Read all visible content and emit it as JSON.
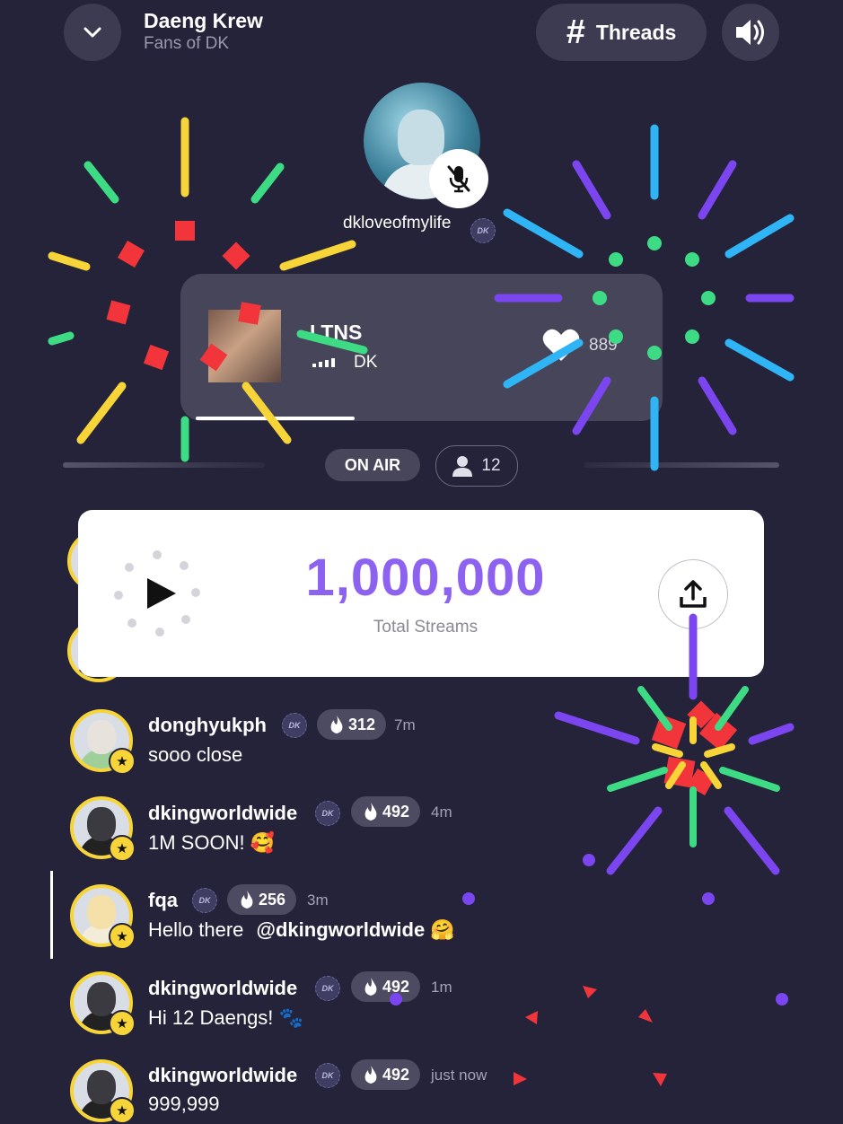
{
  "header": {
    "title": "Daeng Krew",
    "subtitle": "Fans of DK",
    "threads_label": "Threads"
  },
  "host": {
    "username": "dkloveofmylife",
    "badge": "DK"
  },
  "now_playing": {
    "title": "LTNS",
    "artist": "DK",
    "likes": "889",
    "progress_fraction": 0.33
  },
  "status": {
    "on_air": "ON AIR",
    "listeners": "12"
  },
  "streams": {
    "count": "1,000,000",
    "label": "Total Streams"
  },
  "comments": [
    {
      "user": "donghyukph",
      "badge": "DK",
      "score": "312",
      "time": "7m",
      "text": "sooo close",
      "avatar": "cartoon"
    },
    {
      "user": "dkingworldwide",
      "badge": "DK",
      "score": "492",
      "time": "4m",
      "text": "1M SOON! 🥰",
      "avatar": "dark"
    },
    {
      "user": "fqa",
      "badge": "DK",
      "score": "256",
      "time": "3m",
      "text": "Hello there",
      "mention": "@dkingworldwide",
      "emoji": "🤗",
      "avatar": "light"
    },
    {
      "user": "dkingworldwide",
      "badge": "DK",
      "score": "492",
      "time": "1m",
      "text": "Hi 12 Daengs! 🐾",
      "avatar": "dark"
    },
    {
      "user": "dkingworldwide",
      "badge": "DK",
      "score": "492",
      "time": "just now",
      "text": "999,999",
      "avatar": "dark"
    }
  ],
  "icons": {
    "collapse": "chevron-down-icon",
    "threads": "hash-icon",
    "sound": "speaker-icon",
    "mute": "mic-off-icon",
    "like": "heart-icon",
    "share": "share-icon",
    "play": "play-icon",
    "listeners": "person-icon",
    "score": "flame-icon"
  },
  "colors": {
    "background": "#24233a",
    "accent": "#8e62f0",
    "avatar_ring": "#f7d437"
  }
}
